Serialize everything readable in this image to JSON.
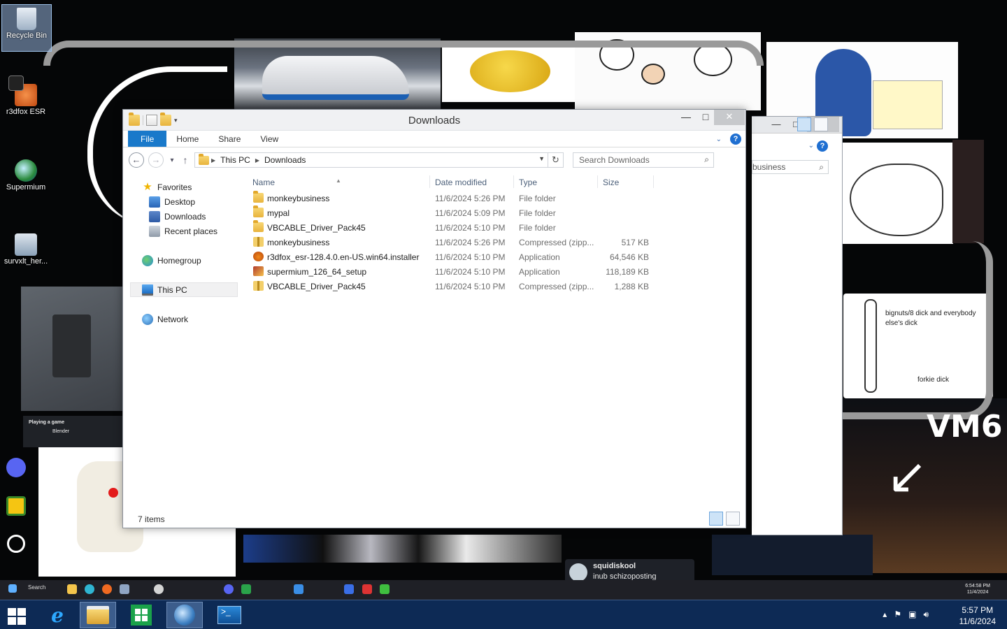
{
  "window": {
    "title": "Downloads",
    "min_symbol": "—",
    "max_symbol": "□",
    "close_symbol": "✕"
  },
  "ribbon": {
    "tabs": [
      "File",
      "Home",
      "Share",
      "View"
    ],
    "help_label": "?"
  },
  "address": {
    "crumbs": [
      "This PC",
      "Downloads"
    ],
    "search_placeholder": "Search Downloads"
  },
  "nav": {
    "favorites": "Favorites",
    "desktop": "Desktop",
    "downloads": "Downloads",
    "recent": "Recent places",
    "homegroup": "Homegroup",
    "this_pc": "This PC",
    "network": "Network"
  },
  "columns": {
    "name": "Name",
    "date": "Date modified",
    "type": "Type",
    "size": "Size"
  },
  "files": [
    {
      "name": "monkeybusiness",
      "date": "11/6/2024 5:26 PM",
      "type": "File folder",
      "size": "",
      "icon": "folder-icon"
    },
    {
      "name": "mypal",
      "date": "11/6/2024 5:09 PM",
      "type": "File folder",
      "size": "",
      "icon": "folder-icon"
    },
    {
      "name": "VBCABLE_Driver_Pack45",
      "date": "11/6/2024 5:10 PM",
      "type": "File folder",
      "size": "",
      "icon": "folder-icon"
    },
    {
      "name": "monkeybusiness",
      "date": "11/6/2024 5:26 PM",
      "type": "Compressed (zipp...",
      "size": "517 KB",
      "icon": "zip-folder-icon"
    },
    {
      "name": "r3dfox_esr-128.4.0.en-US.win64.installer",
      "date": "11/6/2024 5:10 PM",
      "type": "Application",
      "size": "64,546 KB",
      "icon": "fox-app-icon"
    },
    {
      "name": "supermium_126_64_setup",
      "date": "11/6/2024 5:10 PM",
      "type": "Application",
      "size": "118,189 KB",
      "icon": "supermium-app-icon"
    },
    {
      "name": "VBCABLE_Driver_Pack45",
      "date": "11/6/2024 5:10 PM",
      "type": "Compressed (zipp...",
      "size": "1,288 KB",
      "icon": "zip-folder-icon"
    }
  ],
  "status": {
    "items": "7 items"
  },
  "background_window": {
    "search_text": "business"
  },
  "desktop_icons": {
    "recycle": "Recycle Bin",
    "r3dfox": "r3dfox ESR",
    "supermium": "Supermium",
    "survxlt": "survxlt_her..."
  },
  "wallpaper_text": {
    "vm6": "VM6",
    "playing": "Playing a game",
    "playing_game": "Blender",
    "activity_user": "squidiskool",
    "activity_msg": "inub schizoposting",
    "note1": "bignuts/8 dick and everybody else's dick",
    "note2": "forkie dick"
  },
  "vm_clock": {
    "time": "6:54:58 PM",
    "date": "11/4/2024"
  },
  "vm_taskbar": {
    "search": "Search"
  },
  "clock": {
    "time": "5:57 PM",
    "date": "11/6/2024"
  },
  "colors": {
    "accent": "#1979ca",
    "taskbar": "#0d2a55"
  }
}
